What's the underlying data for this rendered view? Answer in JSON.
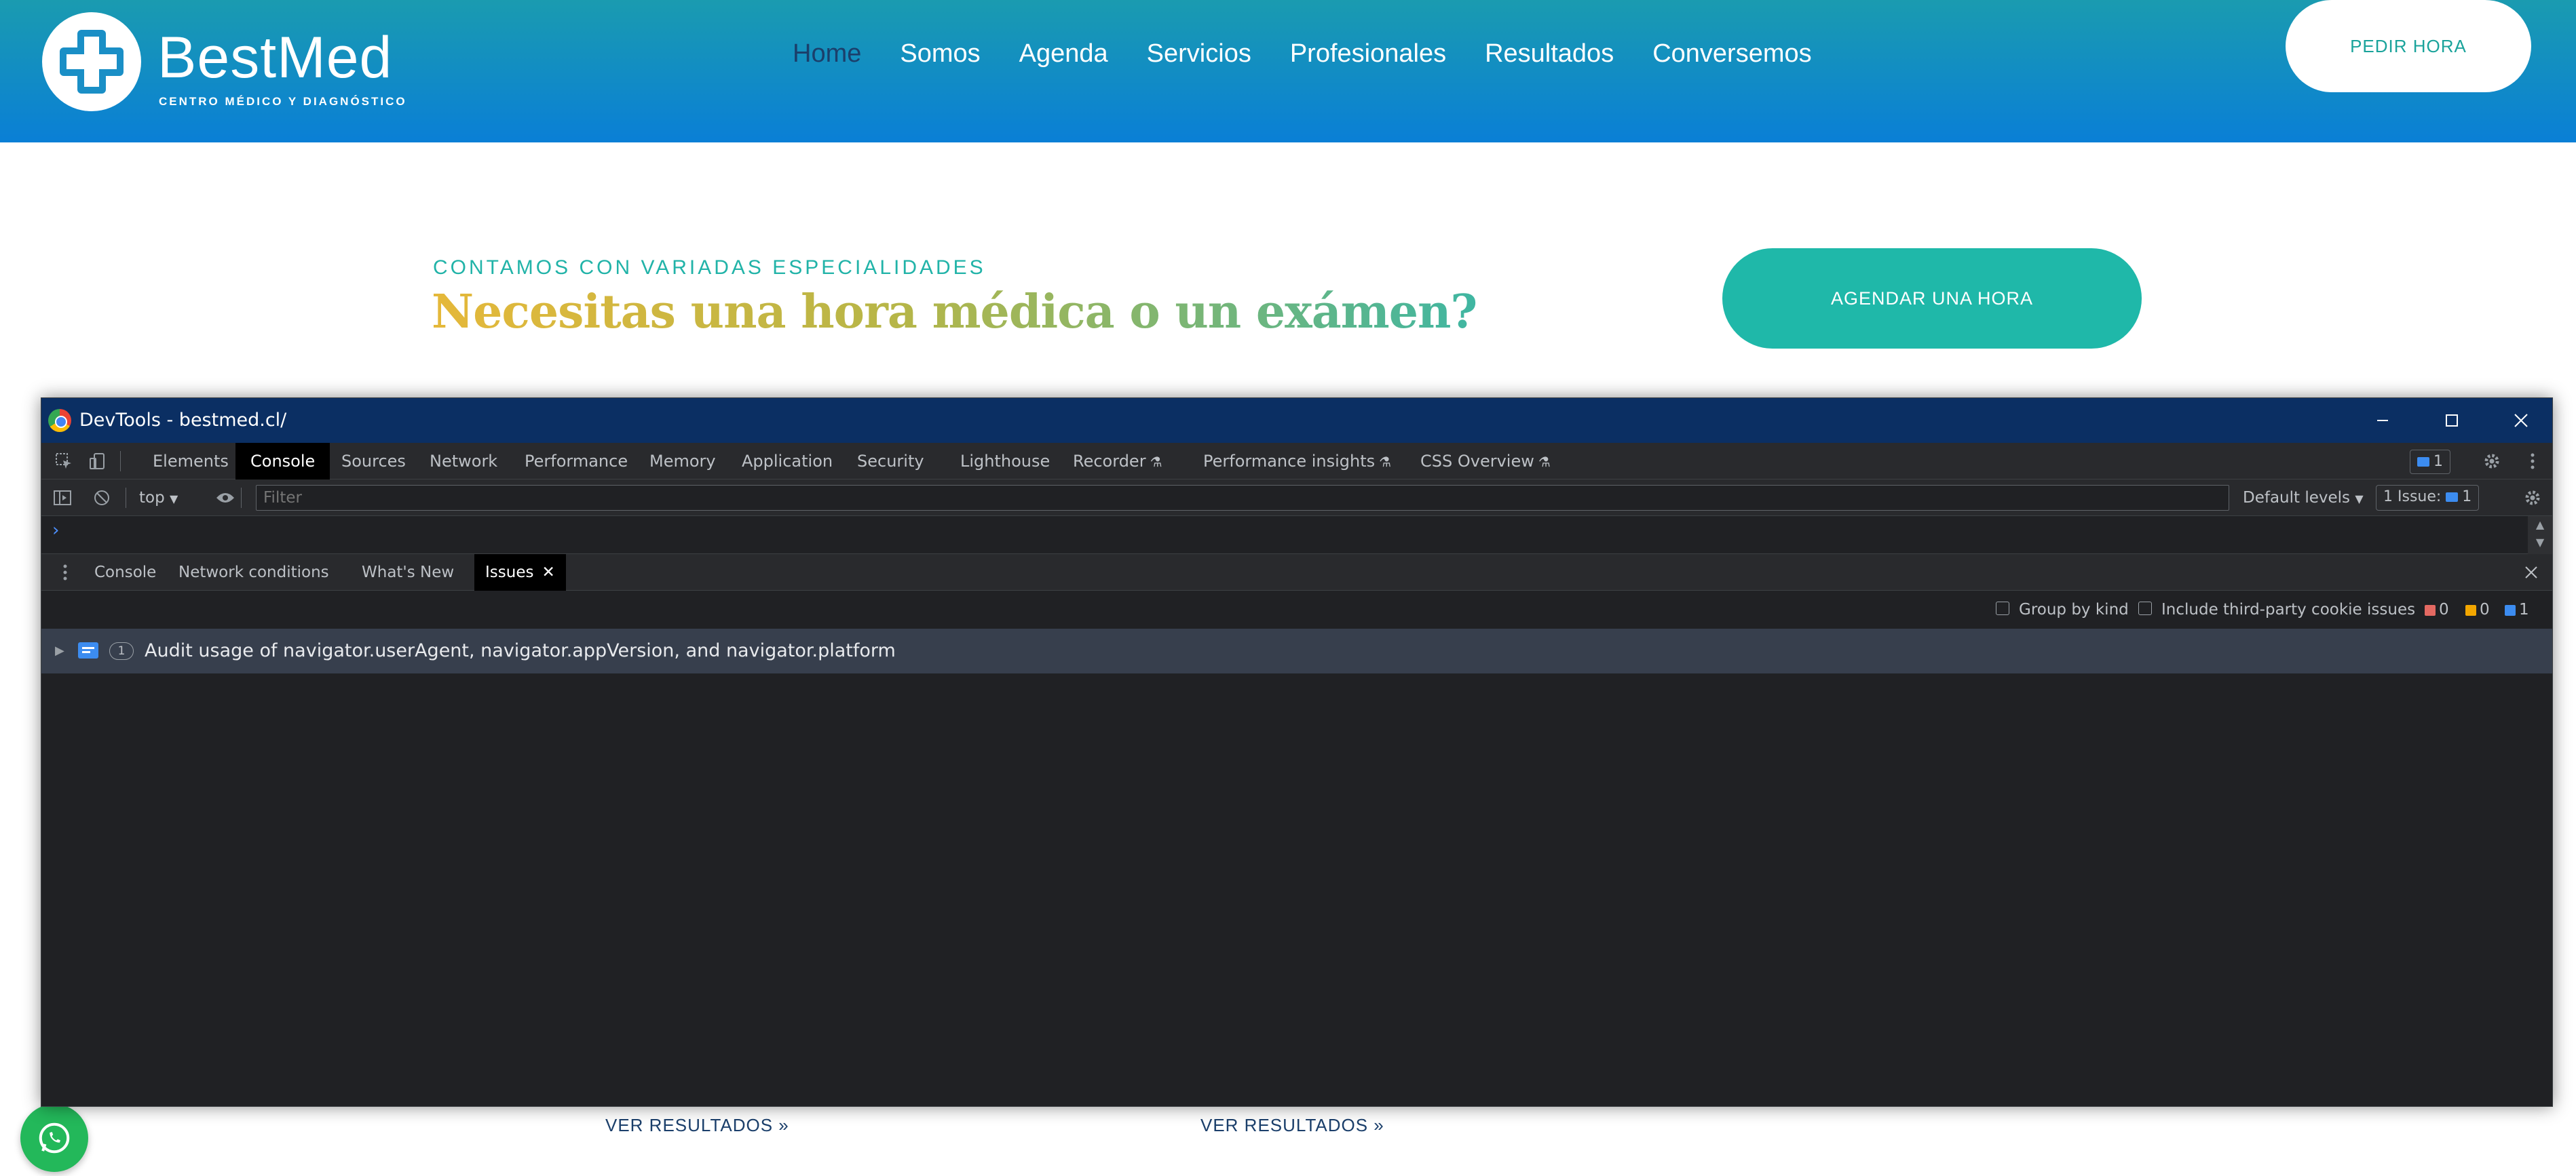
{
  "site": {
    "brand": "BestMed",
    "tagline": "CENTRO MÉDICO Y DIAGNÓSTICO",
    "nav": [
      "Home",
      "Somos",
      "Agenda",
      "Servicios",
      "Profesionales",
      "Resultados",
      "Conversemos"
    ],
    "active_nav": "Home",
    "cta_header": "PEDIR HORA",
    "kicker": "CONTAMOS CON VARIADAS ESPECIALIDADES",
    "hero_title": "Necesitas una hora médica o un exámen?",
    "cta_hero": "AGENDAR UNA HORA",
    "results_link_1": "VER RESULTADOS »",
    "results_link_2": "VER RESULTADOS »",
    "colors": {
      "header_top": "#1a9bb0",
      "header_bottom": "#0a7fd6",
      "accent": "#1fb8a9",
      "nav_active": "#1b3f6b",
      "whatsapp": "#23b85a"
    }
  },
  "devtools": {
    "title": "DevTools - bestmed.cl/",
    "tabs": [
      "Elements",
      "Console",
      "Sources",
      "Network",
      "Performance",
      "Memory",
      "Application",
      "Security",
      "Lighthouse",
      "Recorder",
      "Performance insights",
      "CSS Overview"
    ],
    "active_tab": "Console",
    "issues_badge": "1",
    "context": "top",
    "filter_placeholder": "Filter",
    "levels": "Default levels",
    "issue_summary_label": "1 Issue:",
    "issue_summary_count": "1",
    "drawer_tabs": [
      "Console",
      "Network conditions",
      "What's New",
      "Issues"
    ],
    "active_drawer_tab": "Issues",
    "group_by_kind": "Group by kind",
    "include_third_party": "Include third-party cookie issues",
    "counts": {
      "errors": "0",
      "warnings": "0",
      "info": "1"
    },
    "issues": [
      {
        "count": "1",
        "text": "Audit usage of navigator.userAgent, navigator.appVersion, and navigator.platform"
      }
    ]
  }
}
